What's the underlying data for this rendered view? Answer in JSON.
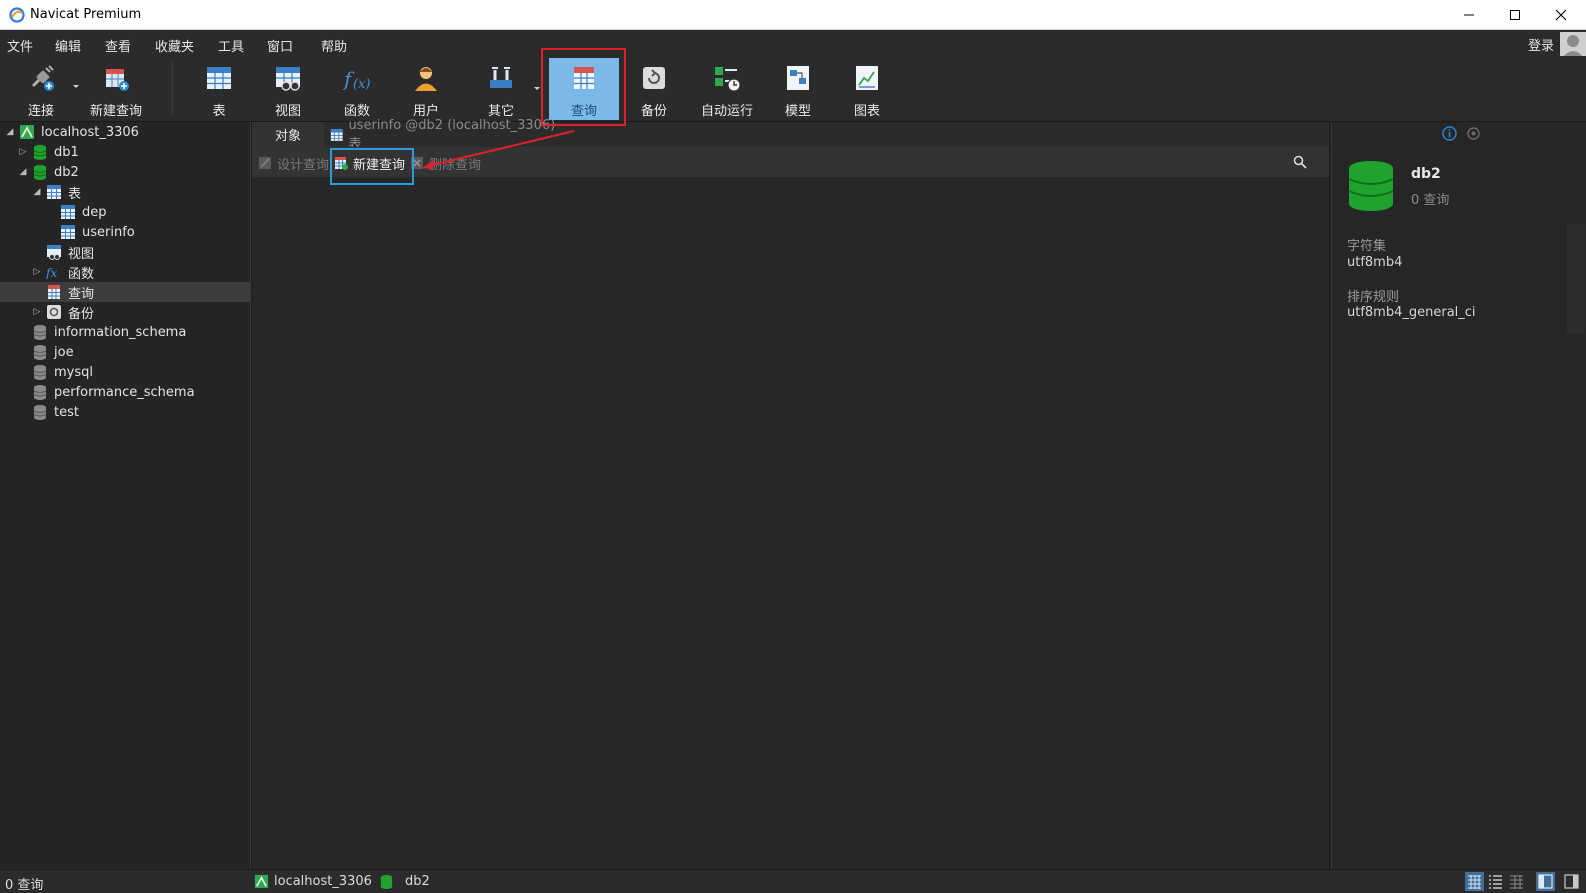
{
  "window": {
    "title": "Navicat Premium"
  },
  "menu": [
    "文件",
    "编辑",
    "查看",
    "收藏夹",
    "工具",
    "窗口",
    "帮助"
  ],
  "login": "登录",
  "toolbar": [
    {
      "id": "connect",
      "label": "连接"
    },
    {
      "id": "new-query",
      "label": "新建查询"
    },
    {
      "id": "table",
      "label": "表"
    },
    {
      "id": "view",
      "label": "视图"
    },
    {
      "id": "function",
      "label": "函数"
    },
    {
      "id": "user",
      "label": "用户"
    },
    {
      "id": "other",
      "label": "其它"
    },
    {
      "id": "query",
      "label": "查询"
    },
    {
      "id": "backup",
      "label": "备份"
    },
    {
      "id": "autorun",
      "label": "自动运行"
    },
    {
      "id": "model",
      "label": "模型"
    },
    {
      "id": "chart",
      "label": "图表"
    }
  ],
  "tree": [
    {
      "label": "localhost_3306",
      "icon": "server-icon",
      "expanded": true
    },
    {
      "label": "db1",
      "icon": "db-green-icon",
      "expanded": false
    },
    {
      "label": "db2",
      "icon": "db-green-icon",
      "expanded": true
    },
    {
      "label": "表",
      "icon": "table-icon",
      "expanded": true
    },
    {
      "label": "dep",
      "icon": "table-icon"
    },
    {
      "label": "userinfo",
      "icon": "table-icon"
    },
    {
      "label": "视图",
      "icon": "view-icon"
    },
    {
      "label": "函数",
      "icon": "function-icon",
      "expanded": false
    },
    {
      "label": "查询",
      "icon": "query-icon",
      "selected": true
    },
    {
      "label": "备份",
      "icon": "backup-icon",
      "expanded": false
    },
    {
      "label": "information_schema",
      "icon": "db-gray-icon"
    },
    {
      "label": "joe",
      "icon": "db-gray-icon"
    },
    {
      "label": "mysql",
      "icon": "db-gray-icon"
    },
    {
      "label": "performance_schema",
      "icon": "db-gray-icon"
    },
    {
      "label": "test",
      "icon": "db-gray-icon"
    }
  ],
  "tabs": {
    "objects": "对象",
    "userinfo": "userinfo @db2 (localhost_3306) - 表"
  },
  "subtoolbar": {
    "design": "设计查询",
    "new": "新建查询",
    "delete": "删除查询"
  },
  "details": {
    "name": "db2",
    "count": "0 查询",
    "charset_label": "字符集",
    "charset_value": "utf8mb4",
    "collation_label": "排序规则",
    "collation_value": "utf8mb4_general_ci"
  },
  "status": {
    "count": "0 查询",
    "connection": "localhost_3306",
    "database": "db2"
  },
  "colors": {
    "accent": "#7ab9e8",
    "highlight_red": "#e0202a",
    "highlight_blue": "#2a9ad9",
    "db_green": "#1fa32e"
  }
}
